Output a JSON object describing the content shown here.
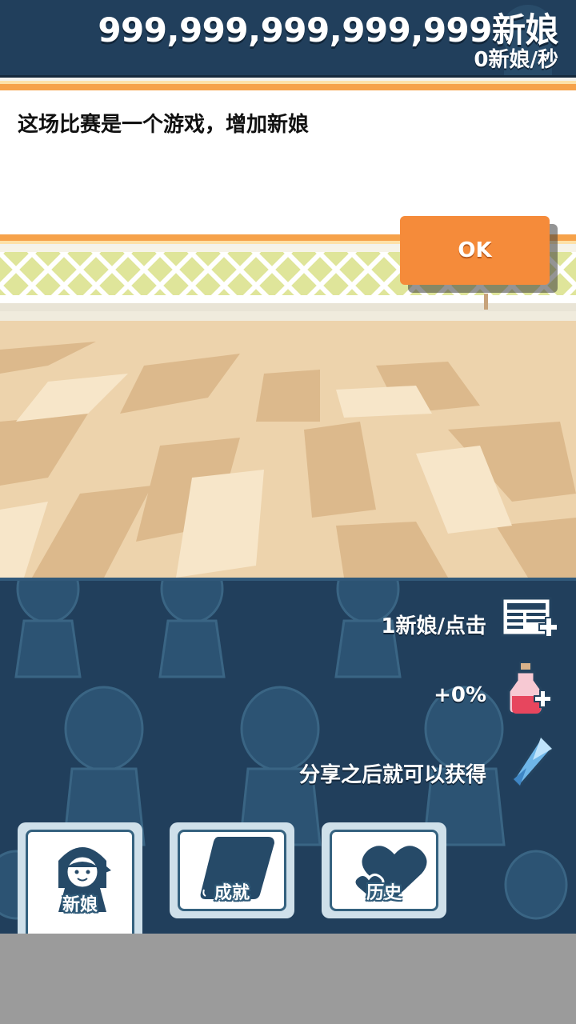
{
  "header": {
    "total_brides": "999,999,999,999,999新娘",
    "rate": "0新娘/秒"
  },
  "dialog": {
    "message": "这场比赛是一个游戏，增加新娘",
    "ok_label": "OK"
  },
  "stats": {
    "per_tap": "1新娘/点击",
    "bonus": "+0%",
    "share": "分享之后就可以获得"
  },
  "nav": {
    "brides_label": "新娘",
    "achievements_label": "成就",
    "history_label": "历史"
  },
  "colors": {
    "header_bg": "#213f5c",
    "accent_orange": "#f58b3a",
    "panel_bg": "#213f5c"
  },
  "icons": {
    "per_tap": "newspaper-plus-icon",
    "bonus": "potion-plus-icon",
    "share": "crystal-icon",
    "brides": "bride-icon",
    "achievements": "book-icon",
    "history": "hearts-icon"
  }
}
